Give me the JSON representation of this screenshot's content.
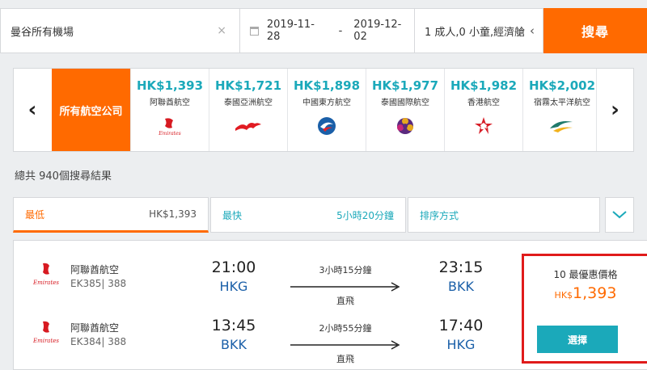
{
  "search": {
    "destination": "曼谷所有機場",
    "clear_icon": "×",
    "depart_date": "2019-11-28",
    "date_separator": "-",
    "return_date": "2019-12-02",
    "passengers": "1 成人,0 小童,經濟艙",
    "pax_chevron": "‹",
    "search_label": "搜尋"
  },
  "carousel": {
    "prev": "‹",
    "next": "›",
    "all_label": "所有航空公司",
    "airlines": [
      {
        "price": "HK$1,393",
        "name": "阿聯酋航空",
        "logo": "emirates-logo"
      },
      {
        "price": "HK$1,721",
        "name": "泰國亞洲航空",
        "logo": "airasia-logo"
      },
      {
        "price": "HK$1,898",
        "name": "中國東方航空",
        "logo": "china-eastern-logo"
      },
      {
        "price": "HK$1,977",
        "name": "泰國國際航空",
        "logo": "thai-airways-logo"
      },
      {
        "price": "HK$1,982",
        "name": "香港航空",
        "logo": "hong-kong-airlines-logo"
      },
      {
        "price": "HK$2,002",
        "name": "宿霧太平洋航空",
        "logo": "cebu-pacific-logo"
      }
    ]
  },
  "results": {
    "count_text": "總共 940個搜尋結果"
  },
  "sort": {
    "cheapest_label": "最低",
    "cheapest_value": "HK$1,393",
    "fastest_label": "最快",
    "fastest_value": "5小時20分鐘",
    "order_label": "排序方式"
  },
  "result": {
    "legs": [
      {
        "airline": "阿聯酋航空",
        "flight": "EK385| 388",
        "dep_time": "21:00",
        "dep_code": "HKG",
        "duration": "3小時15分鐘",
        "stops": "直飛",
        "arr_time": "23:15",
        "arr_code": "BKK"
      },
      {
        "airline": "阿聯酋航空",
        "flight": "EK384| 388",
        "dep_time": "13:45",
        "dep_code": "BKK",
        "duration": "2小時55分鐘",
        "stops": "直飛",
        "arr_time": "17:40",
        "arr_code": "HKG"
      }
    ],
    "deal_title": "10 最優惠價格",
    "currency": "HK$",
    "price": "1,393",
    "select_label": "選擇"
  },
  "colors": {
    "accent_orange": "#ff6a00",
    "teal": "#1ba9ba",
    "highlight_red": "#e01b1b"
  }
}
